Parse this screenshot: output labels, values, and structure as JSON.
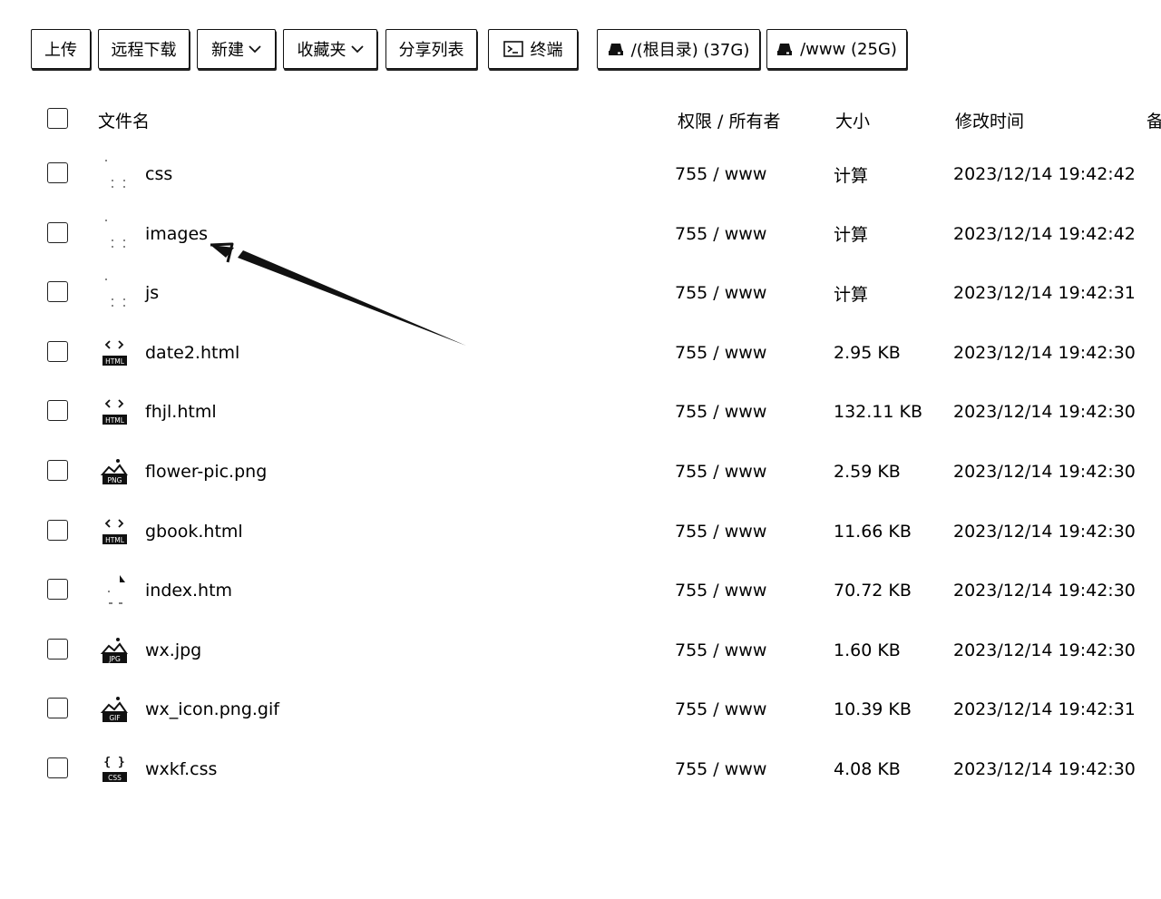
{
  "toolbar": {
    "upload": "上传",
    "remote_download": "远程下载",
    "new": "新建",
    "favorites": "收藏夹",
    "share_list": "分享列表",
    "terminal": "终端",
    "disk_root": "/(根目录) (37G)",
    "disk_www": "/www (25G)"
  },
  "table": {
    "headers": {
      "name": "文件名",
      "perm_owner": "权限 / 所有者",
      "size": "大小",
      "mtime": "修改时间",
      "note": "备"
    },
    "rows": [
      {
        "name": "css",
        "icon": "folder-icon",
        "perm": "755 / www",
        "size": "计算",
        "mtime": "2023/12/14 19:42:42"
      },
      {
        "name": "images",
        "icon": "folder-icon",
        "perm": "755 / www",
        "size": "计算",
        "mtime": "2023/12/14 19:42:42"
      },
      {
        "name": "js",
        "icon": "folder-icon",
        "perm": "755 / www",
        "size": "计算",
        "mtime": "2023/12/14 19:42:31"
      },
      {
        "name": "date2.html",
        "icon": "html-file-icon",
        "perm": "755 / www",
        "size": "2.95 KB",
        "mtime": "2023/12/14 19:42:30"
      },
      {
        "name": "fhjl.html",
        "icon": "html-file-icon",
        "perm": "755 / www",
        "size": "132.11 KB",
        "mtime": "2023/12/14 19:42:30"
      },
      {
        "name": "flower-pic.png",
        "icon": "png-file-icon",
        "perm": "755 / www",
        "size": "2.59 KB",
        "mtime": "2023/12/14 19:42:30"
      },
      {
        "name": "gbook.html",
        "icon": "html-file-icon",
        "perm": "755 / www",
        "size": "11.66 KB",
        "mtime": "2023/12/14 19:42:30"
      },
      {
        "name": "index.htm",
        "icon": "generic-file-icon",
        "perm": "755 / www",
        "size": "70.72 KB",
        "mtime": "2023/12/14 19:42:30"
      },
      {
        "name": "wx.jpg",
        "icon": "jpg-file-icon",
        "perm": "755 / www",
        "size": "1.60 KB",
        "mtime": "2023/12/14 19:42:30"
      },
      {
        "name": "wx_icon.png.gif",
        "icon": "gif-file-icon",
        "perm": "755 / www",
        "size": "10.39 KB",
        "mtime": "2023/12/14 19:42:31"
      },
      {
        "name": "wxkf.css",
        "icon": "css-file-icon",
        "perm": "755 / www",
        "size": "4.08 KB",
        "mtime": "2023/12/14 19:42:30"
      }
    ]
  },
  "icon_badges": {
    "html": "HTML",
    "png": "PNG",
    "jpg": "JPG",
    "gif": "GIF",
    "css": "CSS"
  },
  "annotation": {
    "icon": "arrow-annotation-icon",
    "points_to": "images"
  },
  "colors": {
    "border": "#111111",
    "background": "#ffffff",
    "text": "#000000"
  }
}
